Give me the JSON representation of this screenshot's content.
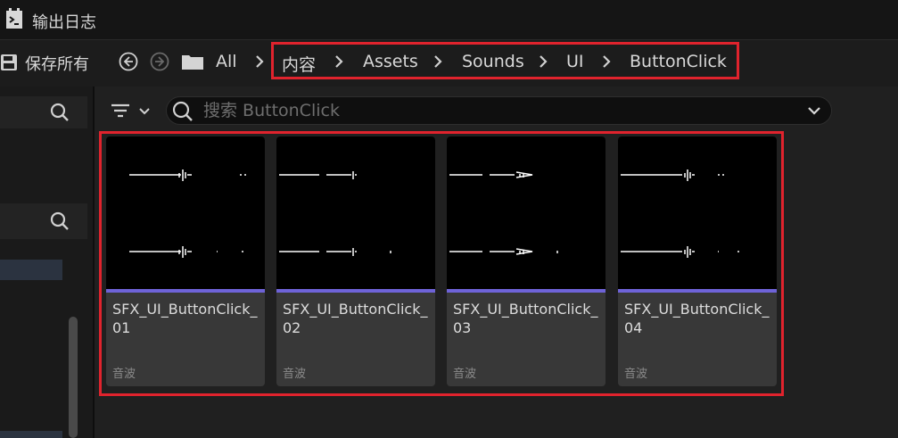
{
  "window": {
    "title": "输出日志"
  },
  "toolbar": {
    "save_all_label": "保存所有"
  },
  "breadcrumb": {
    "items": [
      "All",
      "内容",
      "Assets",
      "Sounds",
      "UI",
      "ButtonClick"
    ]
  },
  "search": {
    "placeholder": "搜索 ButtonClick",
    "value": ""
  },
  "assets": [
    {
      "name": "SFX_UI_ButtonClick_01",
      "type": "音波"
    },
    {
      "name": "SFX_UI_ButtonClick_02",
      "type": "音波"
    },
    {
      "name": "SFX_UI_ButtonClick_03",
      "type": "音波"
    },
    {
      "name": "SFX_UI_ButtonClick_04",
      "type": "音波"
    }
  ],
  "colors": {
    "highlight": "#e0232d",
    "sound_wave_bar": "#6e63d8",
    "card_bg": "#383838"
  },
  "icons": [
    "output-log-icon",
    "save-icon",
    "back-icon",
    "forward-icon",
    "folder-icon",
    "chevron-right-icon",
    "filter-icon",
    "search-icon",
    "chevron-down-icon"
  ]
}
